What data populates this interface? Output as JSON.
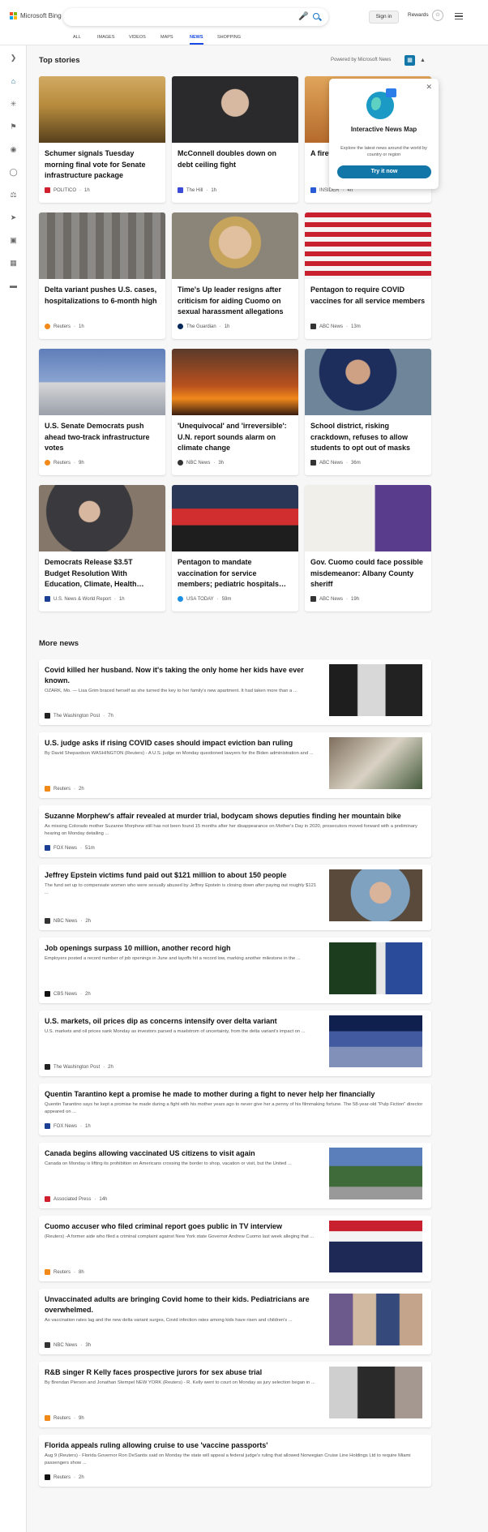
{
  "header": {
    "logo_text": "Microsoft Bing",
    "search_placeholder": "",
    "signin_label": "Sign in",
    "rewards_label": "Rewards",
    "tabs": [
      "ALL",
      "IMAGES",
      "VIDEOS",
      "MAPS",
      "NEWS",
      "SHOPPING"
    ],
    "active_tab": "NEWS"
  },
  "top_stories": {
    "heading": "Top stories",
    "powered_by": "Powered by Microsoft News",
    "cards": [
      {
        "title": "Schumer signals Tuesday morning final vote for Senate infrastructure package",
        "source": "POLITICO",
        "time": "1h",
        "source_color": "#d0202e"
      },
      {
        "title": "McConnell doubles down on debt ceiling fight",
        "source": "The Hill",
        "time": "1h",
        "source_color": "#3a4bd8"
      },
      {
        "title": "A firefighter … Fire in … flames",
        "source": "INSIDER",
        "time": "4h",
        "source_color": "#2a5bd7"
      },
      {
        "title": "Delta variant pushes U.S. cases, hospitalizations to 6-month high",
        "source": "Reuters",
        "time": "1h",
        "source_color": "#f28a1a"
      },
      {
        "title": "Time's Up leader resigns after criticism for aiding Cuomo on sexual harassment allegations",
        "source": "The Guardian",
        "time": "1h",
        "source_color": "#05285a"
      },
      {
        "title": "Pentagon to require COVID vaccines for all service members",
        "source": "ABC News",
        "time": "13m",
        "source_color": "#333333"
      },
      {
        "title": "U.S. Senate Democrats push ahead two-track infrastructure votes",
        "source": "Reuters",
        "time": "9h",
        "source_color": "#f28a1a"
      },
      {
        "title": "'Unequivocal' and 'irreversible': U.N. report sounds alarm on climate change",
        "source": "NBC News",
        "time": "3h",
        "source_color": "#333333"
      },
      {
        "title": "School district, risking crackdown, refuses to allow students to opt out of masks",
        "source": "ABC News",
        "time": "36m",
        "source_color": "#333333"
      },
      {
        "title": "Democrats Release $3.5T Budget Resolution With Education, Climate, Health…",
        "source": "U.S. News & World Report",
        "time": "1h",
        "source_color": "#1c3f94"
      },
      {
        "title": "Pentagon to mandate vaccination for service members; pediatric hospitals…",
        "source": "USA TODAY",
        "time": "59m",
        "source_color": "#1a8fe3"
      },
      {
        "title": "Gov. Cuomo could face possible misdemeanor: Albany County sheriff",
        "source": "ABC News",
        "time": "19h",
        "source_color": "#333333"
      }
    ]
  },
  "popup": {
    "title": "Interactive News Map",
    "description": "Explore the latest news around the world by country or region",
    "button": "Try it now"
  },
  "more_news": {
    "heading": "More news",
    "items": [
      {
        "title": "Covid killed her husband. Now it's taking the only home her kids have ever known.",
        "desc": "OZARK, Mo. — Lisa Grim braced herself as she turned the key to her family's new apartment. It had taken more than a ...",
        "source": "The Washington Post",
        "time": "7h",
        "source_color": "#222222",
        "has_image": true
      },
      {
        "title": "U.S. judge asks if rising COVID cases should impact eviction ban ruling",
        "desc": "By David Shepardson WASHINGTON (Reuters) - A U.S. judge on Monday questioned lawyers for the Biden administration and ...",
        "source": "Reuters",
        "time": "2h",
        "source_color": "#f28a1a",
        "has_image": true
      },
      {
        "title": "Suzanne Morphew's affair revealed at murder trial, bodycam shows deputies finding her mountain bike",
        "desc": "As missing Colorado mother Suzanne Morphew still has not been found 15 months after her disappearance on Mother's Day in 2020, prosecutors moved forward with a preliminary hearing on Monday detailing ...",
        "source": "FOX News",
        "time": "51m",
        "source_color": "#1c3f94",
        "has_image": false
      },
      {
        "title": "Jeffrey Epstein victims fund paid out $121 million to about 150 people",
        "desc": "The fund set up to compensate women who were sexually abused by Jeffrey Epstein is closing down after paying out roughly $121 ...",
        "source": "NBC News",
        "time": "2h",
        "source_color": "#333333",
        "has_image": true
      },
      {
        "title": "Job openings surpass 10 million, another record high",
        "desc": "Employers posted a record number of job openings in June and layoffs hit a record low, marking another milestone in the ...",
        "source": "CBS News",
        "time": "2h",
        "source_color": "#111111",
        "has_image": true
      },
      {
        "title": "U.S. markets, oil prices dip as concerns intensify over delta variant",
        "desc": "U.S. markets and oil prices sank Monday as investors parsed a maelstrom of uncertainty, from the delta variant's impact on ...",
        "source": "The Washington Post",
        "time": "2h",
        "source_color": "#222222",
        "has_image": true
      },
      {
        "title": "Quentin Tarantino kept a promise he made to mother during a fight to never help her financially",
        "desc": "Quentin Tarantino says he kept a promise he made during a fight with his mother years ago to never give her a penny of his filmmaking fortune.  The 58-year-old \"Pulp Fiction\" director appeared on ...",
        "source": "FOX News",
        "time": "1h",
        "source_color": "#1c3f94",
        "has_image": false
      },
      {
        "title": "Canada begins allowing vaccinated US citizens to visit again",
        "desc": "Canada on Monday is lifting its prohibition on Americans crossing the border to shop, vacation or visit, but the United ...",
        "source": "Associated Press",
        "time": "14h",
        "source_color": "#d0202e",
        "has_image": true
      },
      {
        "title": "Cuomo accuser who filed criminal report goes public in TV interview",
        "desc": "(Reuters) -A former aide who filed a criminal complaint against New York state Governor Andrew Cuomo last week alleging that ...",
        "source": "Reuters",
        "time": "8h",
        "source_color": "#f28a1a",
        "has_image": true
      },
      {
        "title": "Unvaccinated adults are bringing Covid home to their kids. Pediatricians are overwhelmed.",
        "desc": "As vaccination rates lag and the new delta variant surges, Covid infection rates among kids have risen and children's ...",
        "source": "NBC News",
        "time": "3h",
        "source_color": "#333333",
        "has_image": true
      },
      {
        "title": "R&B singer R Kelly faces prospective jurors for sex abuse trial",
        "desc": "By Brendan Pierson and Jonathan Stempel NEW YORK (Reuters) - R. Kelly went to court on Monday as jury selection began in ...",
        "source": "Reuters",
        "time": "9h",
        "source_color": "#f28a1a",
        "has_image": true
      },
      {
        "title": "Florida appeals ruling allowing cruise to use 'vaccine passports'",
        "desc": "Aug 9 (Reuters) - Florida Governor Ron DeSantis said on Monday the state will appeal a federal judge's ruling that allowed Norwegian Cruise Line Holdings Ltd to require Miami passengers show ...",
        "source": "Reuters",
        "time": "2h",
        "source_color": "#111111",
        "has_image": false
      }
    ]
  }
}
